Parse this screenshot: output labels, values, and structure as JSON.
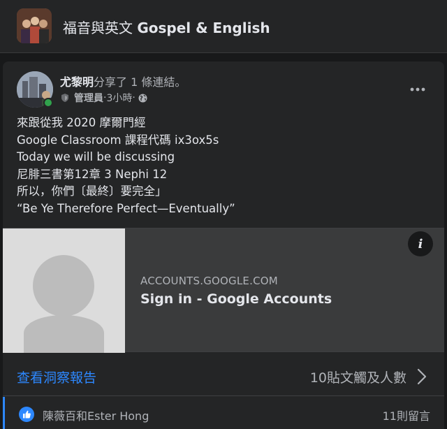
{
  "group": {
    "name_zh": "福音與英文 ",
    "name_en": "Gospel & English"
  },
  "post": {
    "author": "尤黎明",
    "action": "分享了 1 條連結。",
    "role": "管理員",
    "separator": " · ",
    "time": "3小時",
    "time_suffix": " · ",
    "more_label": "•••",
    "body_lines": [
      "來跟從我 2020 摩爾門經",
      "Google Classroom 課程代碼 ix3ox5s",
      "Today we will be discussing",
      "尼腓三書第12章 3 Nephi 12",
      "所以，你們〔最終〕要完全」",
      "“Be Ye Therefore Perfect—Eventually”"
    ]
  },
  "link_preview": {
    "domain": "ACCOUNTS.GOOGLE.COM",
    "title": "Sign in - Google Accounts",
    "info_label": "i"
  },
  "insights": {
    "link_label": "查看洞察報告",
    "reach_label": "10貼文觸及人數"
  },
  "reactions": {
    "people": "陳薇百和Ester Hong",
    "comments": "11則留言"
  },
  "colors": {
    "background": "#18191a",
    "card": "#242526",
    "accent": "#2d88ff",
    "online": "#31a24c"
  }
}
